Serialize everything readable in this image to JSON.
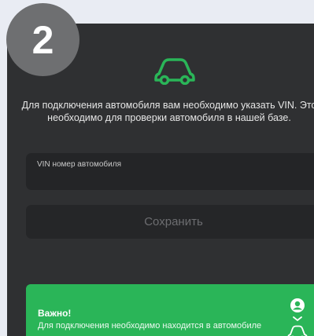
{
  "step": {
    "number": "2"
  },
  "intro": {
    "text": "Для подключения автомобиля вам необходимо указать VIN. Это необходимо для проверки автомобиля в нашей базе."
  },
  "vin": {
    "label": "VIN номер автомобиля",
    "value": ""
  },
  "save": {
    "label": "Сохранить"
  },
  "notice": {
    "title": "Важно!",
    "text": "Для подключения необходимо находится в автомобиле"
  },
  "colors": {
    "accent": "#2ab558",
    "background": "#2f3032",
    "field": "#242527"
  },
  "icons": {
    "header": "car-icon",
    "notice_top": "user-icon",
    "notice_mid": "chevron-down-icon",
    "notice_bottom": "car-icon"
  }
}
